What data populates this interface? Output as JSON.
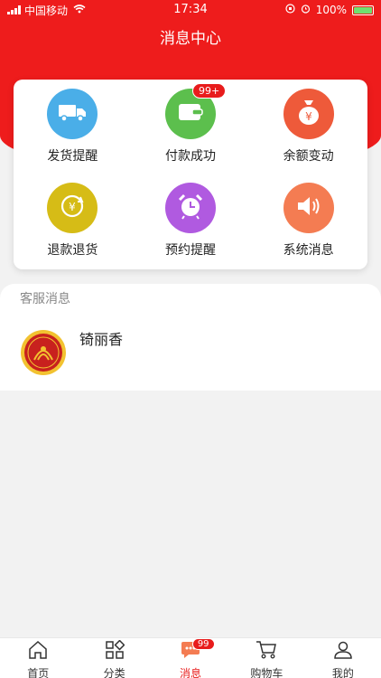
{
  "status_bar": {
    "carrier": "中国移动",
    "time": "17:34",
    "battery": "100%"
  },
  "header": {
    "title": "消息中心"
  },
  "categories": [
    {
      "label": "发货提醒",
      "icon": "truck-icon",
      "color": "#4aaee8"
    },
    {
      "label": "付款成功",
      "icon": "wallet-icon",
      "color": "#5cbf4d",
      "badge": "99+"
    },
    {
      "label": "余额变动",
      "icon": "money-bag-icon",
      "color": "#ee5a3a"
    },
    {
      "label": "退款退货",
      "icon": "refund-icon",
      "color": "#d6bc16"
    },
    {
      "label": "预约提醒",
      "icon": "alarm-clock-icon",
      "color": "#b05ae0"
    },
    {
      "label": "系统消息",
      "icon": "speaker-icon",
      "color": "#f47c52"
    }
  ],
  "service": {
    "section_title": "客服消息",
    "items": [
      {
        "name": "锜丽香",
        "avatar": "brand-logo-avatar"
      }
    ]
  },
  "tabbar": {
    "tabs": [
      {
        "label": "首页",
        "icon": "home-icon"
      },
      {
        "label": "分类",
        "icon": "category-icon"
      },
      {
        "label": "消息",
        "icon": "message-icon",
        "active": true,
        "badge": "99"
      },
      {
        "label": "购物车",
        "icon": "cart-icon"
      },
      {
        "label": "我的",
        "icon": "user-icon"
      }
    ]
  }
}
